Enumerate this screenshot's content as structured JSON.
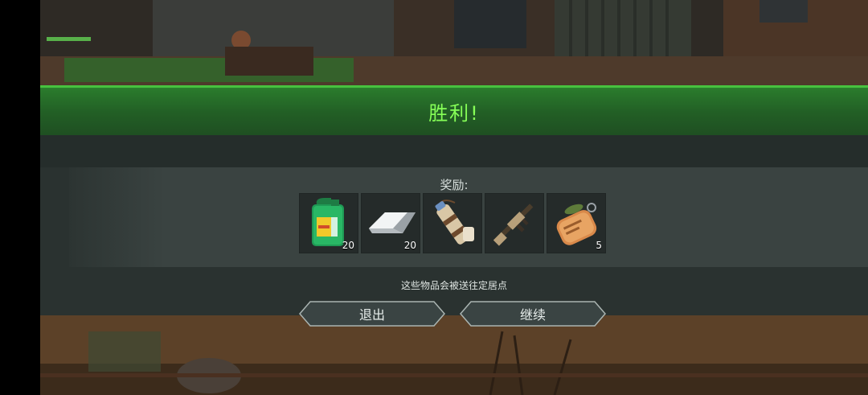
{
  "victory": {
    "title": "胜利!"
  },
  "rewards": {
    "label": "奖励:",
    "items": [
      {
        "icon": "motor-oil-jug-icon",
        "count": "20"
      },
      {
        "icon": "silver-ingot-icon",
        "count": "20"
      },
      {
        "icon": "canteen-flask-icon",
        "count": ""
      },
      {
        "icon": "assault-rifle-icon",
        "count": ""
      },
      {
        "icon": "dog-tag-icon",
        "count": "5"
      }
    ],
    "note": "这些物品会被送往定居点"
  },
  "buttons": {
    "exit": "退出",
    "continue": "继续"
  },
  "colors": {
    "banner_green": "#2a7a2c",
    "title_green": "#86ff57",
    "panel": "#2a3230"
  }
}
